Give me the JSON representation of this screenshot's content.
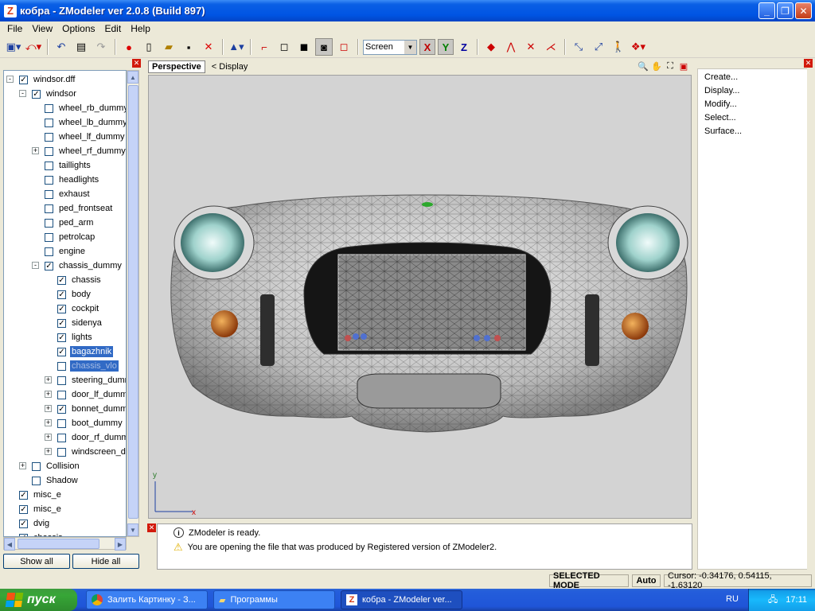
{
  "window": {
    "title": "кобра - ZModeler ver 2.0.8 (Build 897)",
    "app_icon_letter": "Z",
    "buttons": [
      "minimize",
      "maximize",
      "close"
    ]
  },
  "menu": [
    "File",
    "View",
    "Options",
    "Edit",
    "Help"
  ],
  "toolbar": {
    "icons": [
      "new-object-icon",
      "undo-arrow-icon",
      "undo-icon",
      "redo-icon",
      "properties-icon",
      "record-icon",
      "new-file-icon",
      "open-folder-icon",
      "save-icon",
      "delete-icon",
      "pivot-icon",
      "link-icon",
      "box-icon",
      "box-solid-icon",
      "box-shaded-icon",
      "box-red-icon"
    ],
    "coord_mode": "Screen",
    "axes": [
      {
        "label": "X",
        "color": "#c00000",
        "active": true
      },
      {
        "label": "Y",
        "color": "#008000",
        "active": true
      },
      {
        "label": "Z",
        "color": "#0000a0",
        "active": false
      }
    ]
  },
  "tree": {
    "items": [
      {
        "label": "windsor.dff",
        "level": 0,
        "expander": "-",
        "checked": true
      },
      {
        "label": "windsor",
        "level": 1,
        "expander": "-",
        "checked": true
      },
      {
        "label": "wheel_rb_dummy",
        "level": 2,
        "expander": "",
        "checked": false
      },
      {
        "label": "wheel_lb_dummy",
        "level": 2,
        "expander": "",
        "checked": false
      },
      {
        "label": "wheel_lf_dummy",
        "level": 2,
        "expander": "",
        "checked": false
      },
      {
        "label": "wheel_rf_dummy",
        "level": 2,
        "expander": "+",
        "checked": false
      },
      {
        "label": "taillights",
        "level": 2,
        "expander": "",
        "checked": false
      },
      {
        "label": "headlights",
        "level": 2,
        "expander": "",
        "checked": false
      },
      {
        "label": "exhaust",
        "level": 2,
        "expander": "",
        "checked": false
      },
      {
        "label": "ped_frontseat",
        "level": 2,
        "expander": "",
        "checked": false
      },
      {
        "label": "ped_arm",
        "level": 2,
        "expander": "",
        "checked": false
      },
      {
        "label": "petrolcap",
        "level": 2,
        "expander": "",
        "checked": false
      },
      {
        "label": "engine",
        "level": 2,
        "expander": "",
        "checked": false
      },
      {
        "label": "chassis_dummy",
        "level": 2,
        "expander": "-",
        "checked": true
      },
      {
        "label": "chassis",
        "level": 3,
        "expander": "",
        "checked": true
      },
      {
        "label": "body",
        "level": 3,
        "expander": "",
        "checked": true
      },
      {
        "label": "cockpit",
        "level": 3,
        "expander": "",
        "checked": true
      },
      {
        "label": "sidenya",
        "level": 3,
        "expander": "",
        "checked": true
      },
      {
        "label": "lights",
        "level": 3,
        "expander": "",
        "checked": true
      },
      {
        "label": "bagazhnik",
        "level": 3,
        "expander": "",
        "checked": true,
        "selected": true
      },
      {
        "label": "chassis_vlo",
        "level": 3,
        "expander": "",
        "checked": false,
        "selected2": true
      },
      {
        "label": "steering_dumm",
        "level": 3,
        "expander": "+",
        "checked": false
      },
      {
        "label": "door_lf_dummy",
        "level": 3,
        "expander": "+",
        "checked": false
      },
      {
        "label": "bonnet_dummy",
        "level": 3,
        "expander": "+",
        "checked": true
      },
      {
        "label": "boot_dummy",
        "level": 3,
        "expander": "+",
        "checked": false
      },
      {
        "label": "door_rf_dummy",
        "level": 3,
        "expander": "+",
        "checked": false
      },
      {
        "label": "windscreen_du",
        "level": 3,
        "expander": "+",
        "checked": false
      },
      {
        "label": "Collision",
        "level": 1,
        "expander": "+",
        "checked": false
      },
      {
        "label": "Shadow",
        "level": 1,
        "expander": "",
        "checked": false
      },
      {
        "label": "misc_e",
        "level": 0,
        "expander": "",
        "checked": true
      },
      {
        "label": "misc_e",
        "level": 0,
        "expander": "",
        "checked": true
      },
      {
        "label": "dvig",
        "level": 0,
        "expander": "",
        "checked": true
      },
      {
        "label": "chassis",
        "level": 0,
        "expander": "",
        "checked": true
      }
    ],
    "show_all": "Show all",
    "hide_all": "Hide all"
  },
  "viewport": {
    "tab": "Perspective",
    "display_label": "<  Display",
    "axis_y": "y",
    "axis_x": "x",
    "icons": [
      "zoom-icon",
      "pan-icon",
      "maximize-view-icon",
      "close-view-icon"
    ]
  },
  "commands": [
    "Create...",
    "Display...",
    "Modify...",
    "Select...",
    "Surface..."
  ],
  "log": [
    {
      "icon": "info-icon",
      "text": "ZModeler is ready."
    },
    {
      "icon": "warning-icon",
      "text": "You are opening the file that was produced by Registered version of ZModeler2."
    }
  ],
  "status": {
    "mode": "SELECTED MODE",
    "auto": "Auto",
    "cursor": "Cursor: -0.34176, 0.54115, -1.63120"
  },
  "taskbar": {
    "start": "пуск",
    "tasks": [
      "Залить Картинку - З...",
      "Программы",
      "кобра - ZModeler ver..."
    ],
    "lang": "RU",
    "time": "17:11"
  }
}
